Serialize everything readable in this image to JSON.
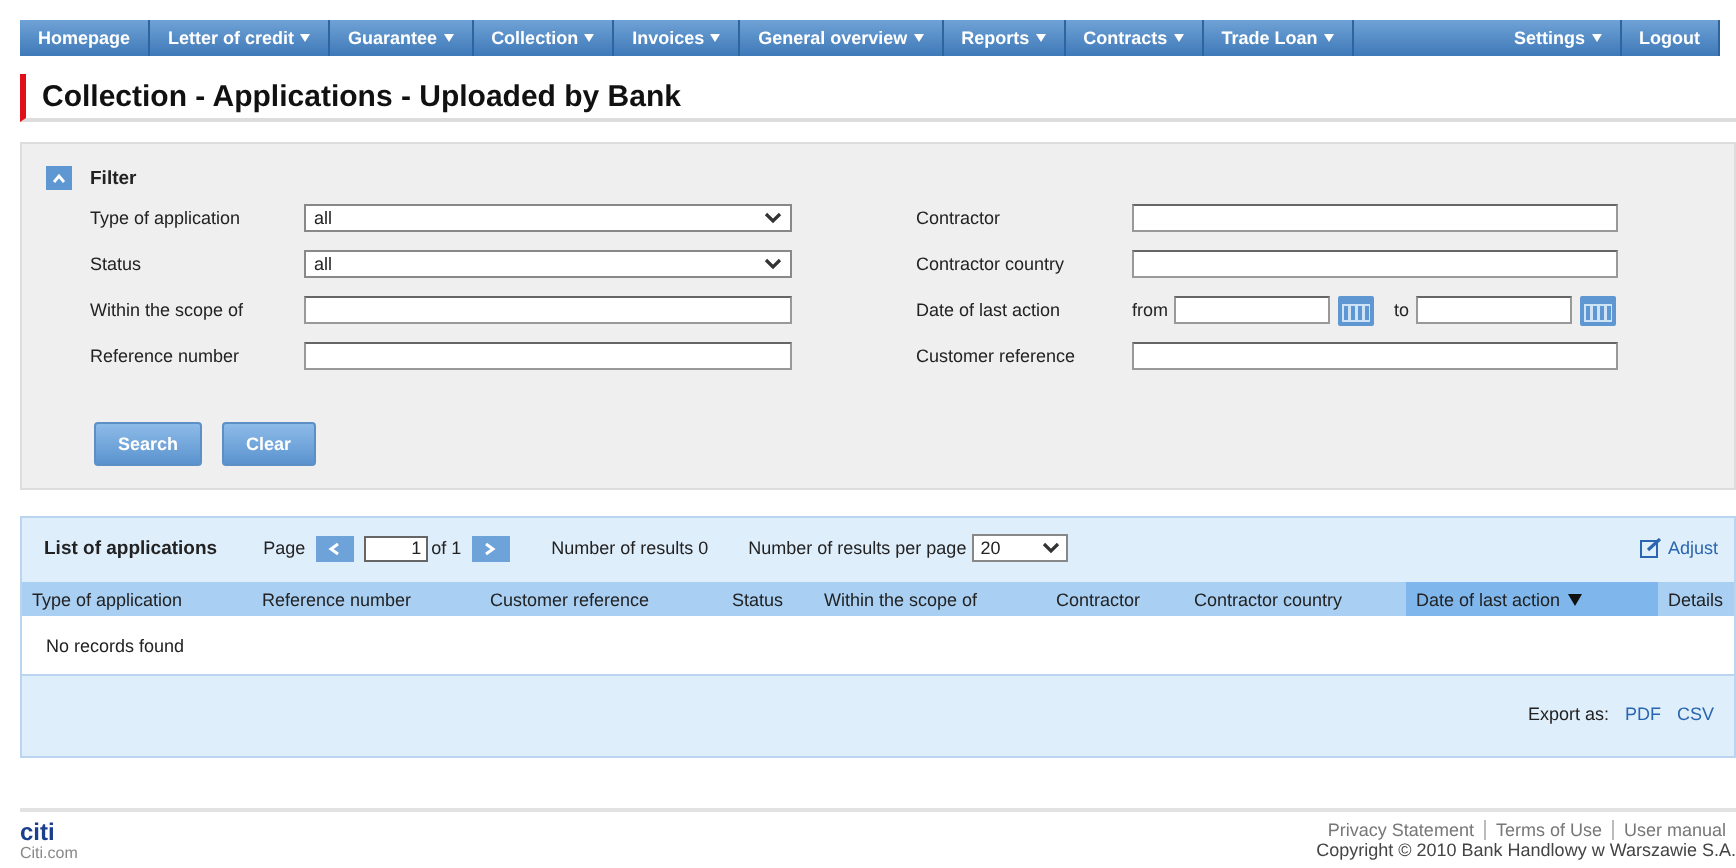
{
  "nav": {
    "left": [
      {
        "label": "Homepage",
        "dropdown": false
      },
      {
        "label": "Letter of credit",
        "dropdown": true
      },
      {
        "label": "Guarantee",
        "dropdown": true
      },
      {
        "label": "Collection",
        "dropdown": true
      },
      {
        "label": "Invoices",
        "dropdown": true
      },
      {
        "label": "General overview",
        "dropdown": true
      },
      {
        "label": "Reports",
        "dropdown": true
      },
      {
        "label": "Contracts",
        "dropdown": true
      },
      {
        "label": "Trade Loan",
        "dropdown": true
      }
    ],
    "right": [
      {
        "label": "Settings",
        "dropdown": true
      },
      {
        "label": "Logout",
        "dropdown": false
      }
    ]
  },
  "page_title": "Collection - Applications - Uploaded by Bank",
  "filter": {
    "title": "Filter",
    "expanded": true,
    "left": [
      {
        "label": "Type of application",
        "kind": "select",
        "value": "all"
      },
      {
        "label": "Status",
        "kind": "select",
        "value": "all"
      },
      {
        "label": "Within the scope of",
        "kind": "text"
      },
      {
        "label": "Reference number",
        "kind": "text"
      }
    ],
    "right": [
      {
        "label": "Contractor",
        "kind": "text"
      },
      {
        "label": "Contractor country",
        "kind": "text"
      },
      {
        "label": "Date of last action",
        "kind": "daterange",
        "from": "from",
        "to": "to"
      },
      {
        "label": "Customer reference",
        "kind": "text"
      }
    ],
    "buttons": [
      "Search",
      "Clear"
    ]
  },
  "list": {
    "title": "List of applications",
    "page_label": "Page",
    "page_value": "1",
    "page_of": "of 1",
    "results": "Number of results 0",
    "per_page_label": "Number of results per page",
    "per_page": "20",
    "adjust": "Adjust",
    "columns": [
      {
        "label": "Type of application",
        "sorted": false
      },
      {
        "label": "Reference number",
        "sorted": false
      },
      {
        "label": "Customer reference",
        "sorted": false
      },
      {
        "label": "Status",
        "sorted": false
      },
      {
        "label": "Within the scope of",
        "sorted": false
      },
      {
        "label": "Contractor",
        "sorted": false
      },
      {
        "label": "Contractor country",
        "sorted": false
      },
      {
        "label": "Date of last action",
        "sorted": true
      },
      {
        "label": "Details",
        "sorted": false
      }
    ],
    "empty": "No records found",
    "export_label": "Export as:",
    "exports": [
      "PDF",
      "CSV"
    ]
  },
  "footer": {
    "logo": "citi",
    "site": "Citi.com",
    "links": [
      "Privacy Statement",
      "Terms of Use",
      "User manual"
    ],
    "copyright": "Copyright © 2010 Bank Handlowy w Warszawie S.A."
  }
}
